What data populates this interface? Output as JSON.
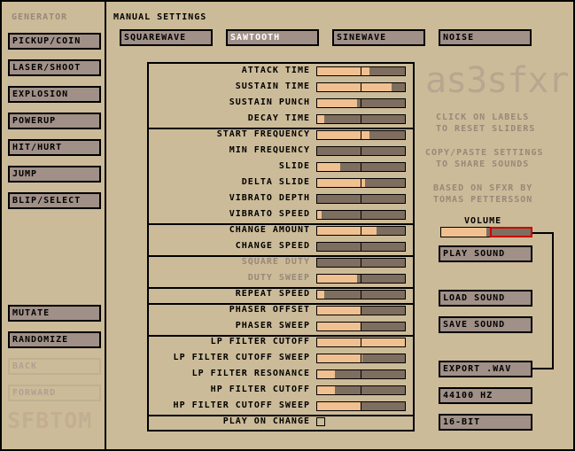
{
  "generator": {
    "title": "GENERATOR",
    "presets": [
      "PICKUP/COIN",
      "LASER/SHOOT",
      "EXPLOSION",
      "POWERUP",
      "HIT/HURT",
      "JUMP",
      "BLIP/SELECT"
    ],
    "mutate": "MUTATE",
    "randomize": "RANDOMIZE",
    "back": "BACK",
    "forward": "FORWARD",
    "logo": "SFBTOM"
  },
  "manual": {
    "title": "MANUAL SETTINGS",
    "waveforms": [
      "SQUAREWAVE",
      "SAWTOOTH",
      "SINEWAVE",
      "NOISE"
    ],
    "selected_waveform": "SAWTOOTH"
  },
  "params": [
    {
      "label": "ATTACK TIME",
      "value": 0.6,
      "enabled": true
    },
    {
      "label": "SUSTAIN TIME",
      "value": 0.85,
      "enabled": true
    },
    {
      "label": "SUSTAIN PUNCH",
      "value": 0.45,
      "enabled": true
    },
    {
      "label": "DECAY TIME",
      "value": 0.08,
      "enabled": true
    },
    {
      "label": "START FREQUENCY",
      "value": 0.6,
      "enabled": true
    },
    {
      "label": "MIN FREQUENCY",
      "value": 0.0,
      "enabled": true
    },
    {
      "label": "SLIDE",
      "value": 0.26,
      "enabled": true
    },
    {
      "label": "DELTA SLIDE",
      "value": 0.55,
      "enabled": true
    },
    {
      "label": "VIBRATO DEPTH",
      "value": 0.0,
      "enabled": true
    },
    {
      "label": "VIBRATO SPEED",
      "value": 0.05,
      "enabled": true
    },
    {
      "label": "CHANGE AMOUNT",
      "value": 0.68,
      "enabled": true
    },
    {
      "label": "CHANGE SPEED",
      "value": 0.0,
      "enabled": true
    },
    {
      "label": "SQUARE DUTY",
      "value": 0.0,
      "enabled": false
    },
    {
      "label": "DUTY SWEEP",
      "value": 0.45,
      "enabled": false
    },
    {
      "label": "REPEAT SPEED",
      "value": 0.08,
      "enabled": true
    },
    {
      "label": "PHASER OFFSET",
      "value": 0.5,
      "enabled": true
    },
    {
      "label": "PHASER SWEEP",
      "value": 0.5,
      "enabled": true
    },
    {
      "label": "LP FILTER CUTOFF",
      "value": 1.0,
      "enabled": true
    },
    {
      "label": "LP FILTER CUTOFF SWEEP",
      "value": 0.52,
      "enabled": true
    },
    {
      "label": "LP FILTER RESONANCE",
      "value": 0.2,
      "enabled": true
    },
    {
      "label": "HP FILTER CUTOFF",
      "value": 0.2,
      "enabled": true
    },
    {
      "label": "HP FILTER CUTOFF SWEEP",
      "value": 0.5,
      "enabled": true
    }
  ],
  "play_on_change": {
    "label": "PLAY ON CHANGE",
    "checked": false
  },
  "right": {
    "logo": "as3sfxr",
    "info1": [
      "CLICK ON LABELS",
      "TO RESET SLIDERS"
    ],
    "info2": [
      "COPY/PASTE SETTINGS",
      "TO SHARE SOUNDS"
    ],
    "info3": [
      "BASED ON SFXR BY",
      "TOMAS PETTERSSON"
    ],
    "volume_label": "VOLUME",
    "volume": 0.5,
    "play": "PLAY SOUND",
    "load": "LOAD SOUND",
    "save": "SAVE SOUND",
    "export": "EXPORT .WAV",
    "rate": "44100 HZ",
    "bits": "16-BIT"
  },
  "colors": {
    "background": "#ccbb99",
    "button": "#a09088",
    "slider_fill": "#f0c090",
    "slider_track": "#7e6e60",
    "accent": "#cc0000"
  }
}
